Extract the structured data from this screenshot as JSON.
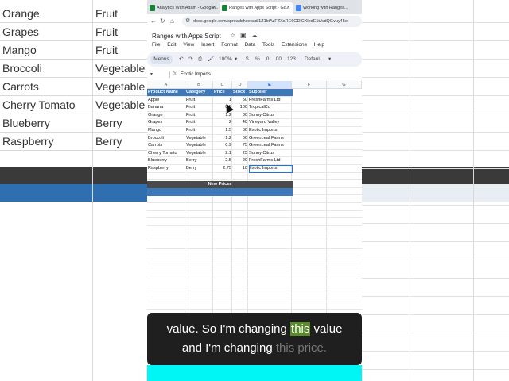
{
  "background": {
    "items": [
      {
        "name": "Orange",
        "category": "Fruit"
      },
      {
        "name": "Grapes",
        "category": "Fruit"
      },
      {
        "name": "Mango",
        "category": "Fruit"
      },
      {
        "name": "Broccoli",
        "category": "Vegetable"
      },
      {
        "name": "Carrots",
        "category": "Vegetable"
      },
      {
        "name": "Cherry Tomato",
        "category": "Vegetable"
      },
      {
        "name": "Blueberry",
        "category": "Berry"
      },
      {
        "name": "Raspberry",
        "category": "Berry"
      }
    ]
  },
  "browser": {
    "tabs": [
      {
        "label": "Analytics With Adam - Google..."
      },
      {
        "label": "Ranges with Apps Script - Go..."
      },
      {
        "label": "Working with Ranges..."
      }
    ],
    "url": "docs.google.com/spreadsheets/d/1Z1ktAzFZXsRE6GDlCXledE1tJvdQGvuy45o"
  },
  "sheet": {
    "title": "Ranges with Apps Script",
    "menu": [
      "File",
      "Edit",
      "View",
      "Insert",
      "Format",
      "Data",
      "Tools",
      "Extensions",
      "Help"
    ],
    "toolbar": {
      "menus_label": "Menus",
      "zoom": "100%",
      "currency": "$",
      "percent": "%",
      "dec_less": ".0",
      "dec_more": ".00",
      "number_format": "123",
      "font": "Defaul..."
    },
    "formula_bar": {
      "value": "Exotic Imports"
    },
    "columns": [
      "A",
      "B",
      "C",
      "D",
      "E",
      "F",
      "G"
    ],
    "headers": [
      "Product Name",
      "Category",
      "Price",
      "Stock",
      "Supplier"
    ],
    "rows": [
      [
        "Apple",
        "Fruit",
        "1",
        "50",
        "FreshFarms Ltd"
      ],
      [
        "Banana",
        "Fruit",
        "0.5",
        "100",
        "TropicalCo"
      ],
      [
        "Orange",
        "Fruit",
        "1.2",
        "80",
        "Sunny Citrus"
      ],
      [
        "Grapes",
        "Fruit",
        "2",
        "40",
        "Vineyard Valley"
      ],
      [
        "Mango",
        "Fruit",
        "1.5",
        "30",
        "Exotic Imports"
      ],
      [
        "Broccoli",
        "Vegetable",
        "1.2",
        "60",
        "GreenLeaf Farms"
      ],
      [
        "Carrots",
        "Vegetable",
        "0.9",
        "75",
        "GreenLeaf Farms"
      ],
      [
        "Cherry Tomato",
        "Vegetable",
        "2.1",
        "25",
        "Sunny Citrus"
      ],
      [
        "Blueberry",
        "Berry",
        "2.5",
        "20",
        "FreshFarms Ltd"
      ],
      [
        "Raspberry",
        "Berry",
        "2.75",
        "10",
        "Exotic Imports"
      ]
    ],
    "new_prices_label": "New Prices"
  },
  "caption": {
    "line1_before": "value. So I'm changing ",
    "line1_highlight": "this",
    "line1_after": " value",
    "line2_before": "and I'm changing ",
    "line2_dim": "this price."
  },
  "colors": {
    "header_blue": "#3d78b8",
    "caption_highlight": "#5a8a2e",
    "bottom_bar": "#00f5f5"
  }
}
